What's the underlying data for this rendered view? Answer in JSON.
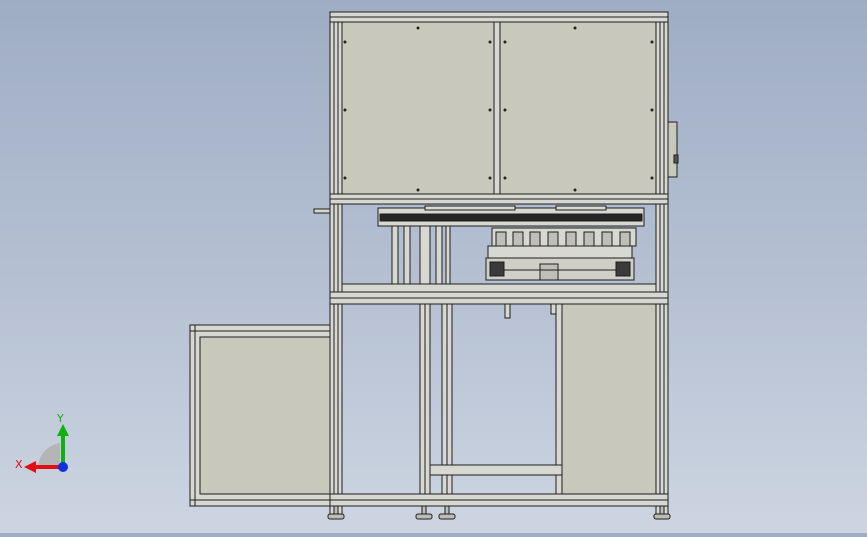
{
  "scene": {
    "background_top": "#9fadc4",
    "background_bottom": "#cdd5e1",
    "panel_color": "#c8c8bd",
    "frame_color": "#d8d8d2",
    "edge_color": "#1e1e1e"
  },
  "triad": {
    "x_label": "X",
    "y_label": "Y",
    "x_color": "#e01010",
    "y_color": "#10b010",
    "z_color": "#1030e0",
    "icons": [
      "x-axis-arrow-icon",
      "y-axis-arrow-icon",
      "z-axis-dot-icon"
    ]
  }
}
